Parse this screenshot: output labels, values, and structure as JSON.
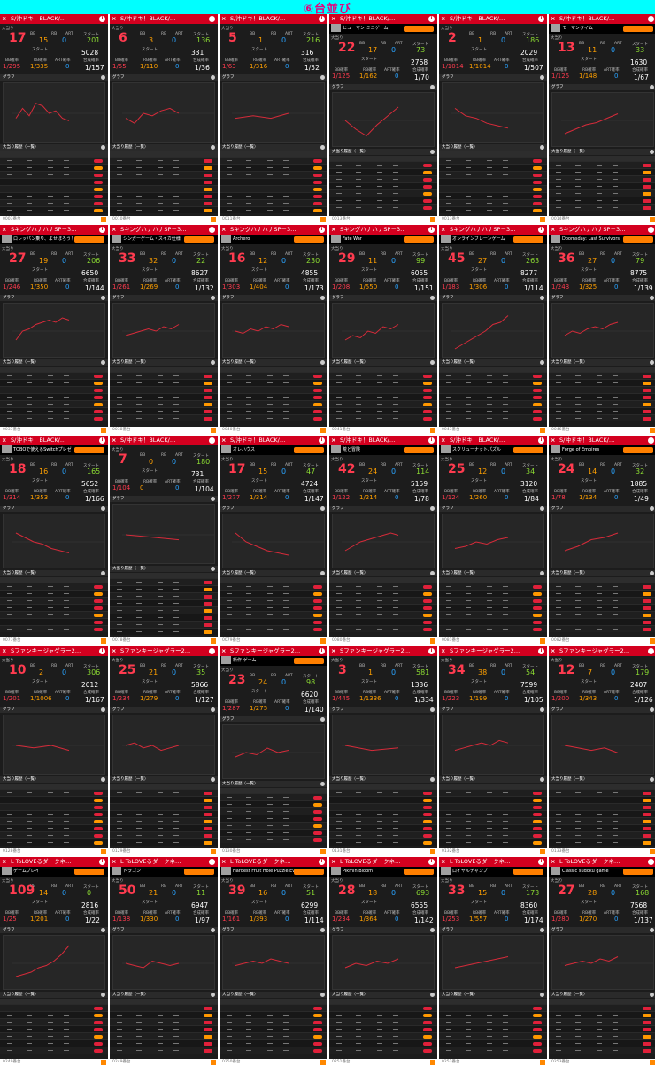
{
  "banner": {
    "title": "⑥台並び"
  },
  "labels": {
    "big": "大当り",
    "bb": "BB",
    "rb": "RB",
    "art": "ART",
    "start": "スタート",
    "graph": "グラフ",
    "history": "大当り履歴（一覧）",
    "at_prob": "ART確率",
    "bb_prob": "BB確率",
    "rb_prob": "RB確率",
    "total_prob": "合成確率",
    "close": "×",
    "info": "i"
  },
  "colors": {
    "header": "#d3001f",
    "bb": "#ffa000",
    "rb": "#29a3ff",
    "art": "#8cdc32",
    "line": "#d62b3a"
  },
  "rows": [
    {
      "title": "S/沖ドキ！BLACK/…",
      "tiles": [
        {
          "ad": "",
          "big": "17",
          "bb": "15",
          "rb": "0",
          "art": "201",
          "start": "5028",
          "bb_prob": "1/295",
          "rb_prob": "1/335",
          "art_prob": "0",
          "total": "1/157",
          "foot": "0003番台",
          "trend": [
            0.6,
            0.4,
            0.55,
            0.3,
            0.35,
            0.5,
            0.45,
            0.6,
            0.65
          ]
        },
        {
          "ad": "",
          "big": "6",
          "bb": "3",
          "rb": "0",
          "art": "136",
          "start": "331",
          "bb_prob": "1/55",
          "rb_prob": "1/110",
          "art_prob": "0",
          "total": "1/36",
          "foot": "0010番台",
          "trend": [
            0.6,
            0.7,
            0.5,
            0.55,
            0.45,
            0.4,
            0.5
          ]
        },
        {
          "ad": "",
          "big": "5",
          "bb": "1",
          "rb": "0",
          "art": "216",
          "start": "316",
          "bb_prob": "1/63",
          "rb_prob": "1/316",
          "art_prob": "0",
          "total": "1/52",
          "foot": "0011番台",
          "trend": [
            0.6,
            0.55,
            0.6,
            0.5
          ]
        },
        {
          "ad": "ヒューマン ミニゲーム",
          "big": "22",
          "bb": "17",
          "rb": "0",
          "art": "73",
          "start": "2768",
          "bb_prob": "1/125",
          "rb_prob": "1/162",
          "art_prob": "0",
          "total": "1/70",
          "foot": "0013番台",
          "trend": [
            0.5,
            0.7,
            0.85,
            0.6,
            0.4,
            0.2
          ]
        },
        {
          "ad": "",
          "big": "2",
          "bb": "1",
          "rb": "0",
          "art": "186",
          "start": "2029",
          "bb_prob": "1/1014",
          "rb_prob": "1/1014",
          "art_prob": "0",
          "total": "1/507",
          "foot": "0013番台",
          "trend": [
            0.4,
            0.55,
            0.6,
            0.7,
            0.75,
            0.8
          ]
        },
        {
          "ad": "モーマンタイム",
          "big": "13",
          "bb": "11",
          "rb": "0",
          "art": "33",
          "start": "1630",
          "bb_prob": "1/125",
          "rb_prob": "1/148",
          "art_prob": "0",
          "total": "1/67",
          "foot": "0014番台",
          "trend": [
            0.8,
            0.7,
            0.6,
            0.55,
            0.45,
            0.35
          ]
        }
      ]
    },
    {
      "title": "SキングハナハナSP－3…",
      "tiles": [
        {
          "ad": "ロレッパン乗り、よせぼろう！",
          "big": "27",
          "bb": "19",
          "rb": "0",
          "art": "206",
          "start": "6650",
          "bb_prob": "1/246",
          "rb_prob": "1/350",
          "art_prob": "0",
          "total": "1/144",
          "foot": "0037番台",
          "trend": [
            0.7,
            0.5,
            0.45,
            0.35,
            0.3,
            0.25,
            0.3,
            0.2,
            0.25
          ]
        },
        {
          "ad": "シンガーゲーム・スイカ仕様",
          "big": "33",
          "bb": "32",
          "rb": "0",
          "art": "22",
          "start": "8627",
          "bb_prob": "1/261",
          "rb_prob": "1/269",
          "art_prob": "0",
          "total": "1/132",
          "foot": "0038番台",
          "trend": [
            0.6,
            0.55,
            0.5,
            0.45,
            0.5,
            0.4,
            0.45,
            0.35
          ]
        },
        {
          "ad": "Archero",
          "big": "16",
          "bb": "12",
          "rb": "0",
          "art": "230",
          "start": "4855",
          "bb_prob": "1/303",
          "rb_prob": "1/404",
          "art_prob": "0",
          "total": "1/173",
          "foot": "0040番台",
          "trend": [
            0.5,
            0.55,
            0.45,
            0.5,
            0.4,
            0.45,
            0.35,
            0.4
          ]
        },
        {
          "ad": "Fate War",
          "big": "29",
          "bb": "11",
          "rb": "0",
          "art": "99",
          "start": "6055",
          "bb_prob": "1/208",
          "rb_prob": "1/550",
          "art_prob": "0",
          "total": "1/151",
          "foot": "0041番台",
          "trend": [
            0.7,
            0.6,
            0.65,
            0.5,
            0.55,
            0.4,
            0.45,
            0.35
          ]
        },
        {
          "ad": "オンラインフレーンゲーム",
          "big": "45",
          "bb": "27",
          "rb": "0",
          "art": "263",
          "start": "8277",
          "bb_prob": "1/183",
          "rb_prob": "1/306",
          "art_prob": "0",
          "total": "1/114",
          "foot": "0043番台",
          "trend": [
            0.9,
            0.8,
            0.7,
            0.6,
            0.5,
            0.35,
            0.3,
            0.15
          ]
        },
        {
          "ad": "Doomsday: Last Survivors",
          "big": "36",
          "bb": "27",
          "rb": "0",
          "art": "79",
          "start": "8775",
          "bb_prob": "1/243",
          "rb_prob": "1/325",
          "art_prob": "0",
          "total": "1/139",
          "foot": "0046番台",
          "trend": [
            0.6,
            0.5,
            0.55,
            0.45,
            0.4,
            0.45,
            0.35,
            0.3
          ]
        }
      ]
    },
    {
      "title": "S/沖ドキ！BLACK/…",
      "tiles": [
        {
          "ad": "TOBOで使えるSwitchプレゼ",
          "big": "18",
          "bb": "16",
          "rb": "0",
          "art": "165",
          "start": "5652",
          "bb_prob": "1/314",
          "rb_prob": "1/353",
          "art_prob": "0",
          "total": "1/166",
          "foot": "0077番台",
          "trend": [
            0.3,
            0.4,
            0.5,
            0.55,
            0.65,
            0.7,
            0.75
          ]
        },
        {
          "ad": "",
          "big": "7",
          "bb": "0",
          "rb": "0",
          "art": "180",
          "start": "731",
          "bb_prob": "1/104",
          "rb_prob": "0",
          "art_prob": "0",
          "total": "1/104",
          "foot": "0078番台",
          "trend": [
            0.5,
            0.55,
            0.6
          ]
        },
        {
          "ad": "オレハウス",
          "big": "17",
          "bb": "15",
          "rb": "0",
          "art": "47",
          "start": "4724",
          "bb_prob": "1/277",
          "rb_prob": "1/314",
          "art_prob": "0",
          "total": "1/147",
          "foot": "0079番台",
          "trend": [
            0.3,
            0.5,
            0.6,
            0.7,
            0.75,
            0.8
          ]
        },
        {
          "ad": "荒と冒険",
          "big": "42",
          "bb": "24",
          "rb": "0",
          "art": "114",
          "start": "5159",
          "bb_prob": "1/122",
          "rb_prob": "1/214",
          "art_prob": "0",
          "total": "1/78",
          "foot": "0080番台",
          "trend": [
            0.7,
            0.6,
            0.5,
            0.45,
            0.4,
            0.35,
            0.3,
            0.35
          ]
        },
        {
          "ad": "スクリューナットパズル",
          "big": "25",
          "bb": "12",
          "rb": "0",
          "art": "34",
          "start": "3120",
          "bb_prob": "1/124",
          "rb_prob": "1/260",
          "art_prob": "0",
          "total": "1/84",
          "foot": "0081番台",
          "trend": [
            0.65,
            0.6,
            0.5,
            0.55,
            0.45,
            0.4
          ]
        },
        {
          "ad": "Forge of Empires",
          "big": "24",
          "bb": "14",
          "rb": "0",
          "art": "32",
          "start": "1885",
          "bb_prob": "1/78",
          "rb_prob": "1/134",
          "art_prob": "0",
          "total": "1/49",
          "foot": "0082番台",
          "trend": [
            0.7,
            0.6,
            0.45,
            0.4,
            0.3
          ]
        }
      ]
    },
    {
      "title": "Sファンキージャグラー2…",
      "tiles": [
        {
          "ad": "",
          "big": "10",
          "bb": "2",
          "rb": "0",
          "art": "306",
          "start": "2012",
          "bb_prob": "1/201",
          "rb_prob": "1/1006",
          "art_prob": "0",
          "total": "1/167",
          "foot": "0128番台",
          "trend": [
            0.5,
            0.55,
            0.5,
            0.6
          ]
        },
        {
          "ad": "",
          "big": "25",
          "bb": "21",
          "rb": "0",
          "art": "35",
          "start": "5866",
          "bb_prob": "1/234",
          "rb_prob": "1/279",
          "art_prob": "0",
          "total": "1/127",
          "foot": "0129番台",
          "trend": [
            0.5,
            0.45,
            0.55,
            0.5,
            0.6,
            0.55,
            0.5
          ]
        },
        {
          "ad": "新作 ゲーム",
          "big": "23",
          "bb": "24",
          "rb": "0",
          "art": "98",
          "start": "6620",
          "bb_prob": "1/287",
          "rb_prob": "1/275",
          "art_prob": "0",
          "total": "1/140",
          "foot": "0130番台",
          "trend": [
            0.6,
            0.5,
            0.55,
            0.4,
            0.5,
            0.45
          ]
        },
        {
          "ad": "",
          "big": "3",
          "bb": "1",
          "rb": "0",
          "art": "581",
          "start": "1336",
          "bb_prob": "1/445",
          "rb_prob": "1/1336",
          "art_prob": "0",
          "total": "1/334",
          "foot": "0131番台",
          "trend": [
            0.5,
            0.6,
            0.55
          ]
        },
        {
          "ad": "",
          "big": "34",
          "bb": "38",
          "rb": "0",
          "art": "54",
          "start": "7599",
          "bb_prob": "1/223",
          "rb_prob": "1/199",
          "art_prob": "0",
          "total": "1/105",
          "foot": "0132番台",
          "trend": [
            0.6,
            0.55,
            0.5,
            0.45,
            0.5,
            0.4,
            0.45
          ]
        },
        {
          "ad": "",
          "big": "12",
          "bb": "7",
          "rb": "0",
          "art": "179",
          "start": "2407",
          "bb_prob": "1/200",
          "rb_prob": "1/343",
          "art_prob": "0",
          "total": "1/126",
          "foot": "0133番台",
          "trend": [
            0.5,
            0.55,
            0.6,
            0.55,
            0.65
          ]
        }
      ]
    },
    {
      "title": "L ToLOVEるダークネ…",
      "tiles": [
        {
          "ad": "ゲームプレイ",
          "big": "109",
          "bb": "14",
          "rb": "0",
          "art": "0",
          "start": "2816",
          "bb_prob": "1/25",
          "rb_prob": "1/201",
          "art_prob": "0",
          "total": "1/22",
          "foot": "0249番台",
          "trend": [
            0.8,
            0.75,
            0.7,
            0.6,
            0.55,
            0.45,
            0.3,
            0.1
          ]
        },
        {
          "ad": "ドラゴン",
          "big": "50",
          "bb": "21",
          "rb": "0",
          "art": "11",
          "start": "6947",
          "bb_prob": "1/138",
          "rb_prob": "1/330",
          "art_prob": "0",
          "total": "1/97",
          "foot": "0249番台",
          "trend": [
            0.5,
            0.55,
            0.6,
            0.45,
            0.5,
            0.55,
            0.5
          ]
        },
        {
          "ad": "Hardest Fruit Hole Puzzle Ever!",
          "big": "39",
          "bb": "16",
          "rb": "0",
          "art": "51",
          "start": "6299",
          "bb_prob": "1/161",
          "rb_prob": "1/393",
          "art_prob": "0",
          "total": "1/114",
          "foot": "0250番台",
          "trend": [
            0.55,
            0.5,
            0.45,
            0.5,
            0.4,
            0.45,
            0.5
          ]
        },
        {
          "ad": "Pikmin Bloom",
          "big": "28",
          "bb": "18",
          "rb": "0",
          "art": "693",
          "start": "6555",
          "bb_prob": "1/234",
          "rb_prob": "1/364",
          "art_prob": "0",
          "total": "1/142",
          "foot": "0251番台",
          "trend": [
            0.6,
            0.5,
            0.55,
            0.45,
            0.5,
            0.4
          ]
        },
        {
          "ad": "ロイヤルチャンプ",
          "big": "33",
          "bb": "15",
          "rb": "0",
          "art": "173",
          "start": "8360",
          "bb_prob": "1/253",
          "rb_prob": "1/557",
          "art_prob": "0",
          "total": "1/174",
          "foot": "0252番台",
          "trend": [
            0.6,
            0.55,
            0.5,
            0.45,
            0.4,
            0.35
          ]
        },
        {
          "ad": "Classic sudoku game",
          "big": "27",
          "bb": "28",
          "rb": "0",
          "art": "168",
          "start": "7568",
          "bb_prob": "1/280",
          "rb_prob": "1/270",
          "art_prob": "0",
          "total": "1/137",
          "foot": "0253番台",
          "trend": [
            0.55,
            0.5,
            0.45,
            0.5,
            0.4,
            0.45,
            0.35
          ]
        }
      ]
    }
  ]
}
